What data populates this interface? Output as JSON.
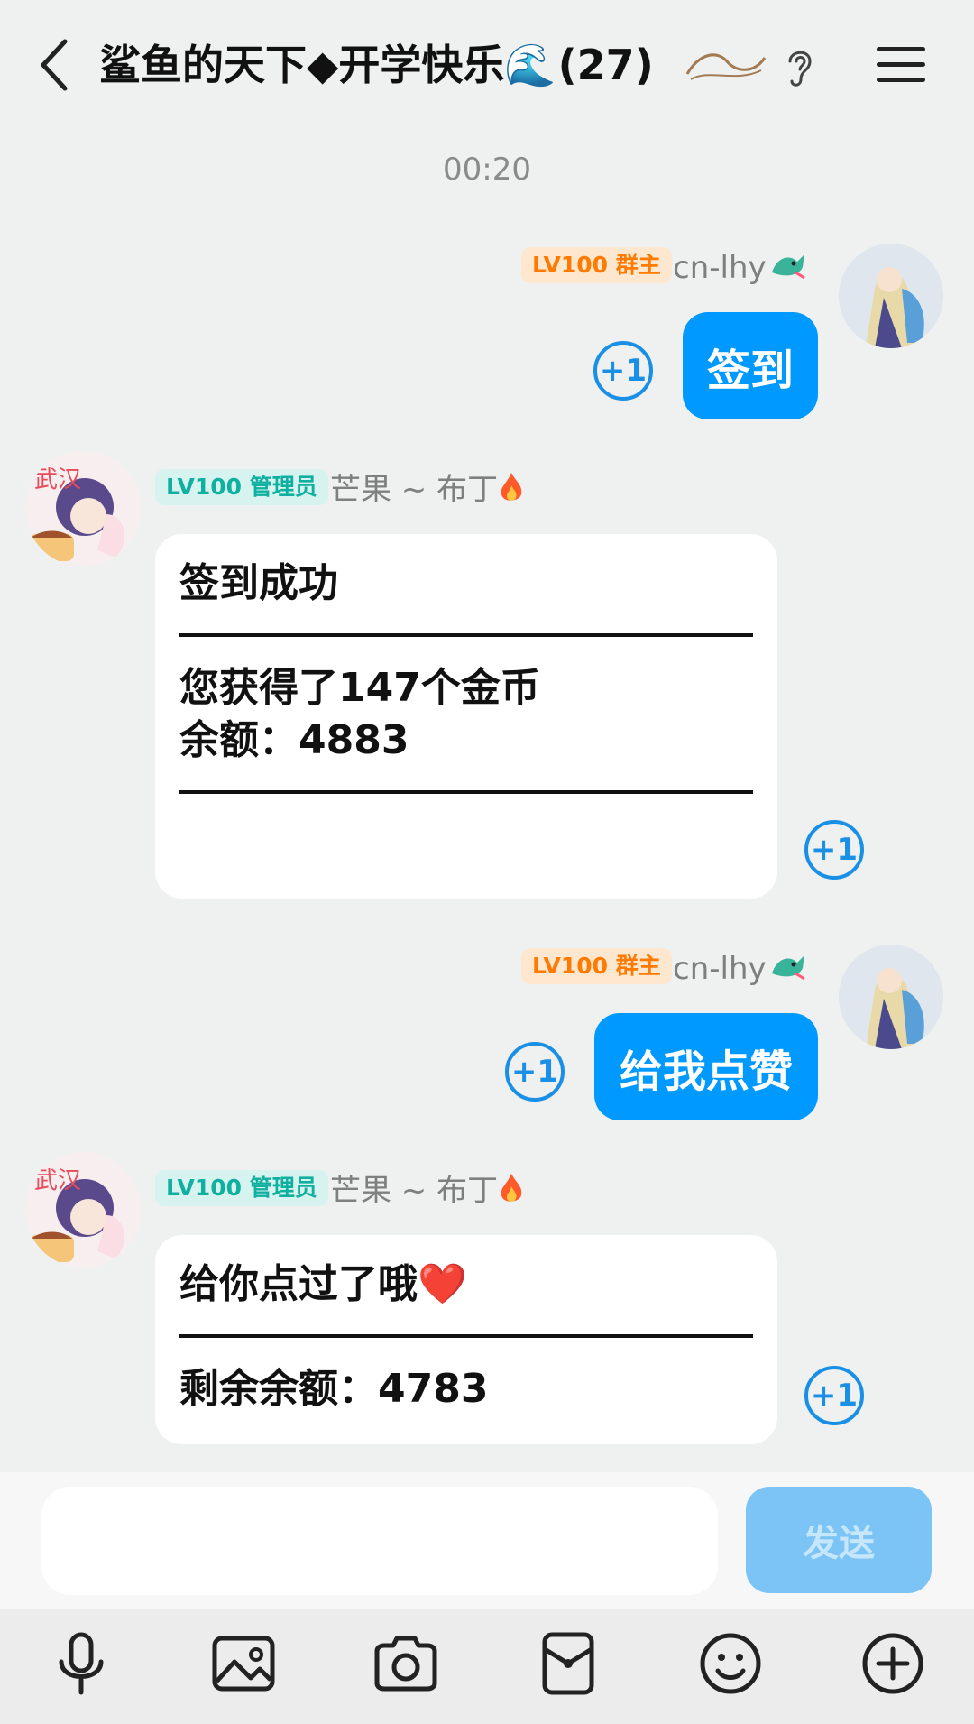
{
  "header": {
    "title": "鲨鱼的天下◆开学快乐🌊",
    "member_count": "(27)"
  },
  "chat": {
    "timestamp": "00:20",
    "messages": [
      {
        "badge": "LV100 群主",
        "nick": "cn-lhy",
        "text": "签到",
        "plus": "+1"
      },
      {
        "badge": "LV100 管理员",
        "nick": "芒果 ~ 布丁",
        "lines": [
          "签到成功",
          "您获得了147个金币",
          "余额：4883"
        ],
        "plus": "+1"
      },
      {
        "badge": "LV100 群主",
        "nick": "cn-lhy",
        "text": "给我点赞",
        "plus": "+1"
      },
      {
        "badge": "LV100 管理员",
        "nick": "芒果 ~ 布丁",
        "lines": [
          "给你点过了哦❤️",
          "剩余余额：4783"
        ],
        "plus": "+1"
      }
    ]
  },
  "input": {
    "placeholder": "",
    "send_label": "发送"
  },
  "toolbar": {
    "icons": [
      "microphone-icon",
      "image-icon",
      "camera-icon",
      "red-packet-icon",
      "emoji-icon",
      "plus-icon"
    ]
  },
  "colors": {
    "accent": "#0099ff",
    "owner_badge": "#ff7a00",
    "admin_badge": "#10b0a0",
    "background": "#eef1f0"
  }
}
